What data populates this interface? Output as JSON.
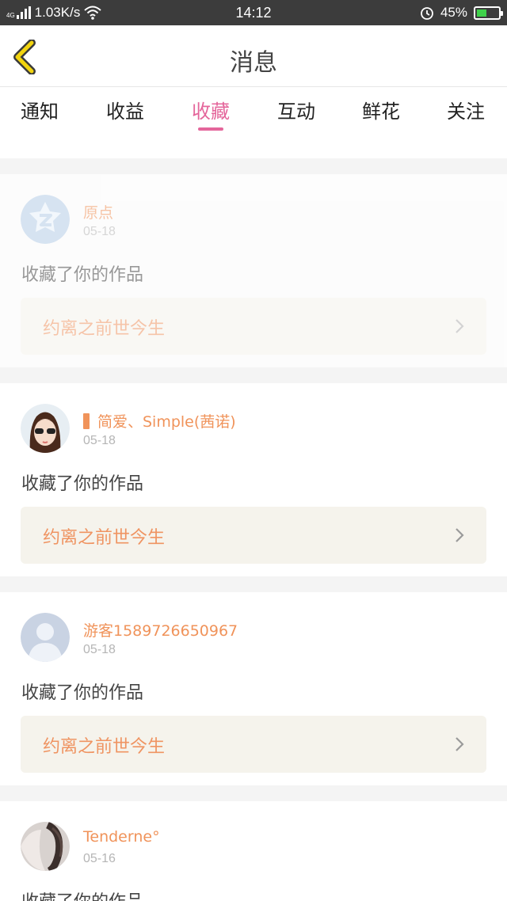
{
  "status_bar": {
    "network_type": "4G",
    "speed": "1.03K/s",
    "time": "14:12",
    "battery": "45%"
  },
  "header": {
    "title": "消息",
    "back_icon": "chevron-left-icon"
  },
  "tabs": [
    {
      "label": "通知"
    },
    {
      "label": "收益"
    },
    {
      "label": "收藏",
      "active": true
    },
    {
      "label": "互动"
    },
    {
      "label": "鲜花"
    },
    {
      "label": "关注"
    }
  ],
  "messages": [
    {
      "user": "原点",
      "date": "05-18",
      "action": "收藏了你的作品",
      "work": "约离之前世今生",
      "faded": true
    },
    {
      "user": "简爱、Simple(茜诺)",
      "date": "05-18",
      "action": "收藏了你的作品",
      "work": "约离之前世今生"
    },
    {
      "user": "游客1589726650967",
      "date": "05-18",
      "action": "收藏了你的作品",
      "work": "约离之前世今生"
    },
    {
      "user": "Tenderne°",
      "date": "05-16",
      "action": "收藏了你的作品"
    }
  ],
  "colors": {
    "accent": "#e4669b",
    "username": "#f0935a",
    "work_bg": "#f5f3ec",
    "back_icon": "#f2d40f"
  }
}
